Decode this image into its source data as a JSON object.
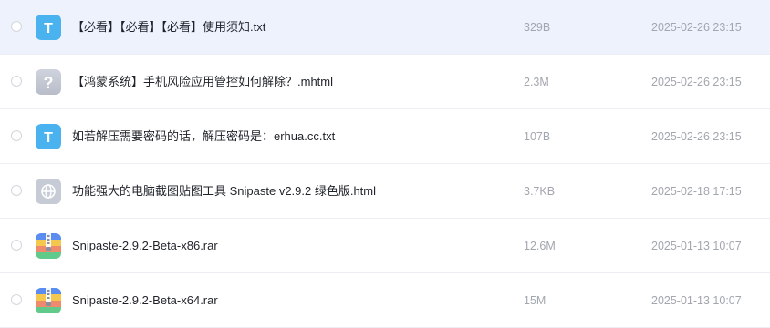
{
  "files": [
    {
      "name": "【必看】【必看】【必看】使用须知.txt",
      "size": "329B",
      "date": "2025-02-26 23:15",
      "icon": "text-file-icon"
    },
    {
      "name": "【鸿蒙系统】手机风险应用管控如何解除？.mhtml",
      "size": "2.3M",
      "date": "2025-02-26 23:15",
      "icon": "unknown-file-icon"
    },
    {
      "name": "如若解压需要密码的话，解压密码是：erhua.cc.txt",
      "size": "107B",
      "date": "2025-02-26 23:15",
      "icon": "text-file-icon"
    },
    {
      "name": "功能强大的电脑截图贴图工具 Snipaste v2.9.2 绿色版.html",
      "size": "3.7KB",
      "date": "2025-02-18 17:15",
      "icon": "web-file-icon"
    },
    {
      "name": "Snipaste-2.9.2-Beta-x86.rar",
      "size": "12.6M",
      "date": "2025-01-13 10:07",
      "icon": "archive-file-icon"
    },
    {
      "name": "Snipaste-2.9.2-Beta-x64.rar",
      "size": "15M",
      "date": "2025-01-13 10:07",
      "icon": "archive-file-icon"
    }
  ],
  "icon_glyphs": {
    "text_letter": "T",
    "unknown_glyph": "?"
  },
  "colors": {
    "text_icon": "#4ab3ef",
    "unknown_icon": "#c3c7d3",
    "web_icon": "#c7cbd6",
    "selected_row": "#eef2fd"
  }
}
